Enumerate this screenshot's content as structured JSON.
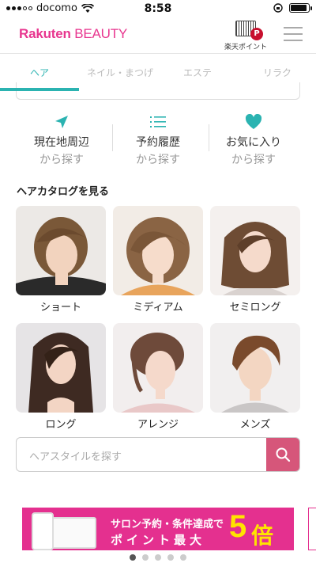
{
  "status_bar": {
    "carrier": "docomo",
    "time": "8:58",
    "battery_level": 0.9
  },
  "header": {
    "logo_brand": "Rakuten",
    "logo_suffix": "BEAUTY",
    "points_label": "楽天ポイント",
    "points_badge": "P"
  },
  "tabs": [
    {
      "label": "ヘア",
      "active": true
    },
    {
      "label": "ネイル・まつげ",
      "active": false
    },
    {
      "label": "エステ",
      "active": false
    },
    {
      "label": "リラク",
      "active": false
    }
  ],
  "quick_actions": [
    {
      "line1": "現在地周辺",
      "line2": "から探す",
      "icon": "location-arrow-icon"
    },
    {
      "line1": "予約履歴",
      "line2": "から探す",
      "icon": "list-icon"
    },
    {
      "line1": "お気に入り",
      "line2": "から探す",
      "icon": "heart-icon"
    }
  ],
  "catalog": {
    "title": "ヘアカタログを見る",
    "items": [
      {
        "label": "ショート"
      },
      {
        "label": "ミディアム"
      },
      {
        "label": "セミロング"
      },
      {
        "label": "ロング"
      },
      {
        "label": "アレンジ"
      },
      {
        "label": "メンズ"
      }
    ]
  },
  "search": {
    "placeholder": "ヘアスタイルを探す",
    "icon": "search-icon"
  },
  "banner": {
    "line1": "サロン予約・条件達成で",
    "line2": "ポイント最大",
    "multiplier_number": "5",
    "multiplier_suffix": "倍"
  },
  "carousel": {
    "total": 5,
    "active_index": 0
  },
  "colors": {
    "brand_pink": "#e8368f",
    "teal_accent": "#2bb3b1",
    "search_button": "#d6567a",
    "heart": "#2bb3b1"
  }
}
